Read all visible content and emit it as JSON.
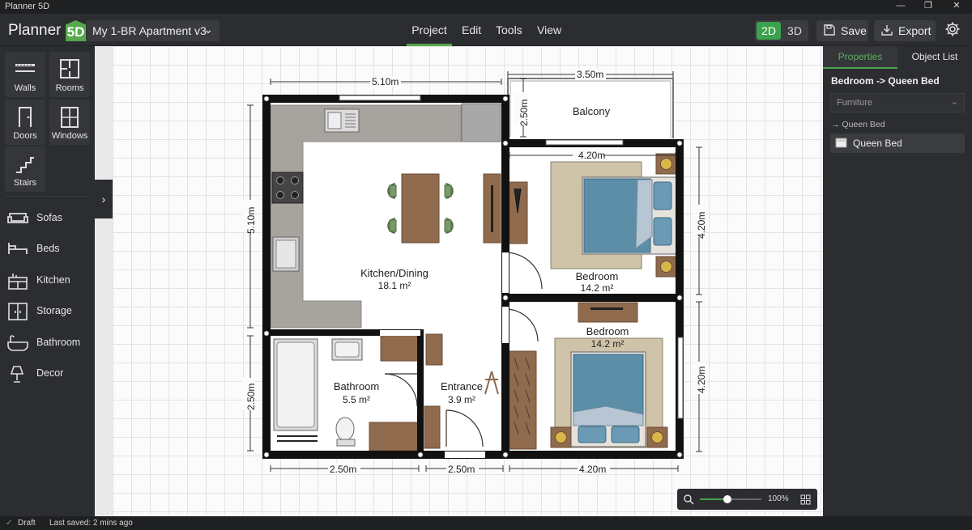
{
  "window": {
    "title": "Planner 5D",
    "min": "—",
    "max": "❐",
    "close": "✕"
  },
  "topbar": {
    "logo_text": "Planner",
    "logo_badge": "5D",
    "project_name": "My 1-BR Apartment v3",
    "menus": [
      "Project",
      "Edit",
      "Tools",
      "View"
    ],
    "active_menu": "Project",
    "view_2d": "2D",
    "view_3d": "3D",
    "save_label": "Save",
    "export_label": "Export"
  },
  "tools": [
    {
      "label": "Walls",
      "icon": "walls-icon"
    },
    {
      "label": "Rooms",
      "icon": "rooms-icon"
    },
    {
      "label": "Doors",
      "icon": "door-icon"
    },
    {
      "label": "Windows",
      "icon": "window-icon"
    },
    {
      "label": "Stairs",
      "icon": "stairs-icon"
    }
  ],
  "categories": [
    {
      "label": "Sofas",
      "icon": "sofa-icon"
    },
    {
      "label": "Beds",
      "icon": "bed-icon"
    },
    {
      "label": "Kitchen",
      "icon": "kitchen-icon"
    },
    {
      "label": "Storage",
      "icon": "storage-icon"
    },
    {
      "label": "Bathroom",
      "icon": "bathtub-icon"
    },
    {
      "label": "Decor",
      "icon": "lamp-icon"
    }
  ],
  "plan": {
    "rooms": [
      {
        "name": "Kitchen/Dining",
        "area": "18.1 m²"
      },
      {
        "name": "Bedroom",
        "area": "14.2 m²"
      },
      {
        "name": "Bedroom",
        "area": "14.2 m²"
      },
      {
        "name": "Bathroom",
        "area": "5.5 m²"
      },
      {
        "name": "Entrance",
        "area": "3.9 m²"
      },
      {
        "name": "Balcony",
        "area": ""
      }
    ],
    "dimensions": {
      "top_main": "5.10m",
      "top_balcony": "3.50m",
      "balcony_side": "2.50m",
      "bedroom_top": "4.20m",
      "left_upper": "5.10m",
      "left_lower": "2.50m",
      "right_upper": "4.20m",
      "right_lower": "4.20m",
      "bottom_left": "2.50m",
      "bottom_mid": "2.50m",
      "bottom_right": "4.20m"
    },
    "colors": {
      "wall": "#111111",
      "floor_kitchen": "#ffffff",
      "counter": "#a7a39e",
      "bed": "#5c8ea8",
      "rug": "#cfc3a9",
      "furniture": "#8f6a4c",
      "chair": "#7a9a6a"
    }
  },
  "zoom": {
    "percent": "100%",
    "level": 0.45
  },
  "properties": {
    "tab_properties": "Properties",
    "tab_object_list": "Object List",
    "active_tab": "Properties",
    "breadcrumb": "Bedroom -> Queen Bed",
    "filter": "Furniture",
    "tree_parent": "→ Queen Bed",
    "tree_item": "Queen Bed"
  },
  "status": {
    "draft": "Draft",
    "last_saved": "Last saved: 2 mins ago"
  }
}
